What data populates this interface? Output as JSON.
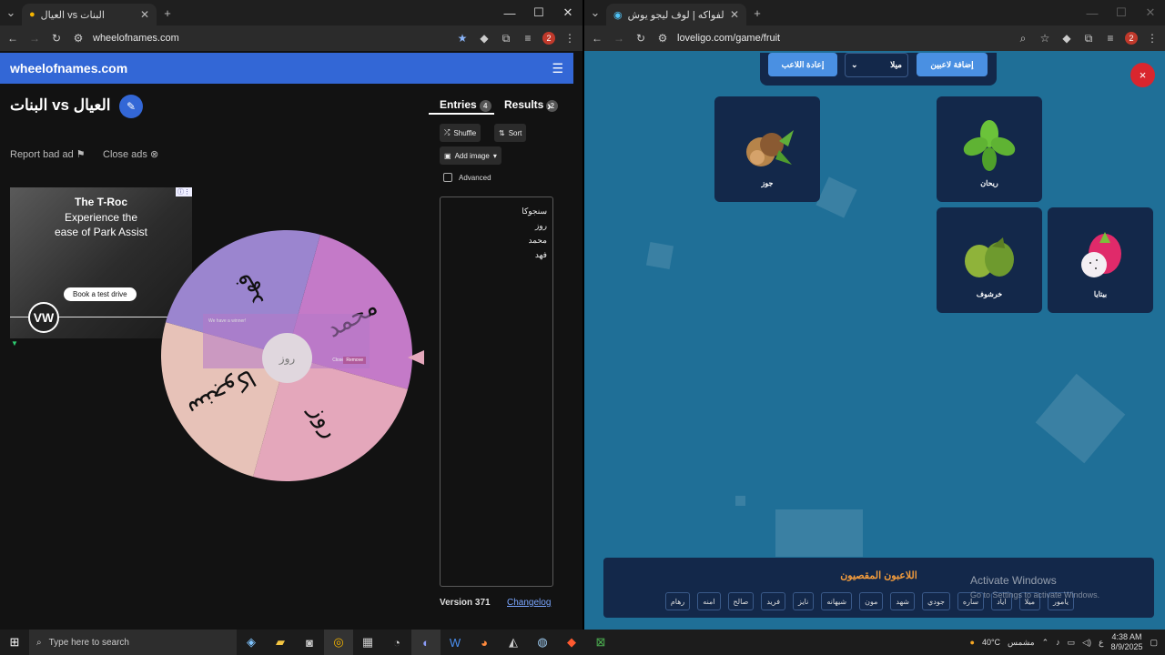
{
  "left_window": {
    "tab_title": "العيال vs البنات",
    "url": "wheelofnames.com",
    "profile_badge": "2",
    "site_brand": "wheelofnames.com",
    "wheel_title": "البنات vs العيال",
    "report_bad_ad": "Report bad ad",
    "close_ads": "Close ads",
    "ad": {
      "line1": "The T-Roc",
      "line2": "Experience the",
      "line3": "ease of Park Assist",
      "cta": "Book a test drive",
      "logo": "VW"
    },
    "wheel": {
      "segments": [
        {
          "label": "محمد",
          "color": "#c47ac8"
        },
        {
          "label": "روز",
          "color": "#e4a7bb"
        },
        {
          "label": "سنجوكا",
          "color": "#e7c2b8"
        },
        {
          "label": "فهد",
          "color": "#9b85cf"
        }
      ],
      "hub_text": "روز",
      "dialog_placeholder": "We have a winner!",
      "dialog_close": "Close",
      "dialog_remove": "Remove"
    },
    "sidebar": {
      "entries_tab": "Entries",
      "entries_count": "4",
      "results_tab": "Results",
      "results_count": "2",
      "shuffle": "Shuffle",
      "sort": "Sort",
      "add_image": "Add image",
      "advanced": "Advanced",
      "entries": [
        "سنجوكا",
        "روز",
        "محمد",
        "فهد"
      ],
      "version": "Version 371",
      "changelog": "Changelog"
    }
  },
  "right_window": {
    "tab_title": "لعبة حرب الفواكه | لوف ليجو يوش",
    "url": "loveligo.com/game/fruit",
    "profile_badge": "2",
    "reset_button": "إعادة اللاعب",
    "player_select": "ميلا",
    "add_players": "إضافة لاعبين",
    "close_icon": "×",
    "cards": [
      {
        "name": "جوز"
      },
      {
        "name": "ريحان"
      },
      {
        "name": "خرشوف"
      },
      {
        "name": "بيتايا"
      }
    ],
    "eliminated_title": "اللاعبون المقصيون",
    "eliminated": [
      "يامور",
      "ميلا",
      "اياد",
      "ساره",
      "جودي",
      "شهد",
      "مون",
      "شيهانه",
      "نايز",
      "فريد",
      "صالح",
      "امنه",
      "رهام"
    ]
  },
  "watermark": {
    "line1": "Activate Windows",
    "line2": "Go to Settings to activate Windows."
  },
  "taskbar": {
    "search_placeholder": "Type here to search",
    "temperature": "40°C",
    "weather": "مشمس",
    "lang": "ع",
    "time": "4:38 AM",
    "date": "8/9/2025"
  }
}
